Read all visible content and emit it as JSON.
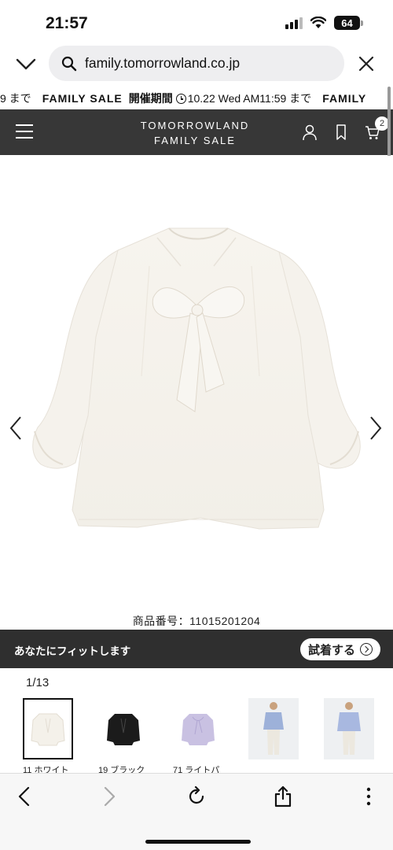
{
  "status": {
    "time": "21:57",
    "battery": "64"
  },
  "browser": {
    "url": "family.tomorrowland.co.jp"
  },
  "marquee": {
    "lead": "9 まで",
    "sale": "FAMILY SALE",
    "period": "開催期間",
    "date": "10.22 Wed AM11:59 まで",
    "tail": "FAMILY"
  },
  "header": {
    "logo_line1": "TOMORROWLAND",
    "logo_line2": "FAMILY SALE",
    "cart_count": "2"
  },
  "product": {
    "sku": "商品番号：11015201204"
  },
  "fit": {
    "text": "あなたにフィットします",
    "button": "試着する"
  },
  "gallery": {
    "counter": "1/13",
    "thumbs": [
      {
        "label": "11 ホワイト"
      },
      {
        "label": "19 ブラック"
      },
      {
        "label": "71 ライトパ"
      },
      {
        "label": ""
      },
      {
        "label": ""
      }
    ]
  },
  "colors": {
    "header": "#373737",
    "fitbar": "#2f2f2f",
    "accent_gray": "#eeeef0"
  }
}
